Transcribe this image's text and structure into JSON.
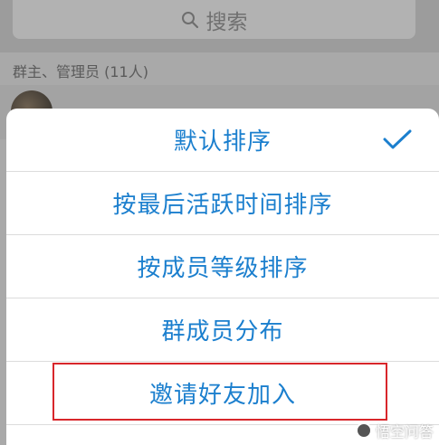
{
  "search": {
    "placeholder": "搜索",
    "icon": "search-icon"
  },
  "members": {
    "section_label": "群主、管理员 (11人)"
  },
  "menu": {
    "items": [
      {
        "label": "默认排序",
        "selected": true
      },
      {
        "label": "按最后活跃时间排序",
        "selected": false
      },
      {
        "label": "按成员等级排序",
        "selected": false
      },
      {
        "label": "群成员分布",
        "selected": false
      },
      {
        "label": "邀请好友加入",
        "selected": false,
        "highlighted": true
      }
    ],
    "accent_color": "#1b7fce",
    "highlight_color": "#d8262b"
  },
  "watermark": {
    "text": "悟空问答"
  }
}
